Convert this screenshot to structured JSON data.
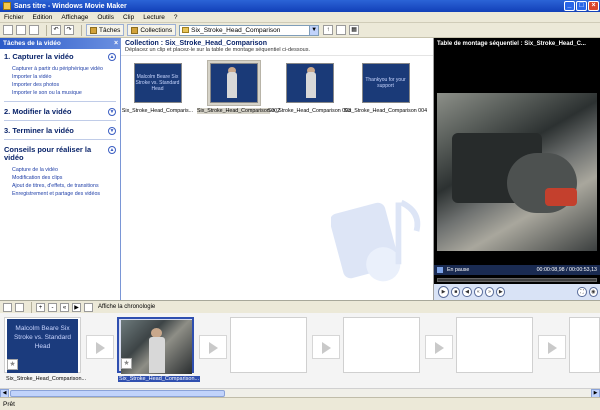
{
  "window": {
    "title": "Sans titre - Windows Movie Maker"
  },
  "menu": [
    "Fichier",
    "Edition",
    "Affichage",
    "Outils",
    "Clip",
    "Lecture",
    "?"
  ],
  "toolbar": {
    "tasks_label": "Tâches",
    "collections_label": "Collections",
    "collection_select": "Six_Stroke_Head_Comparison"
  },
  "taskpane": {
    "header": "Tâches de la vidéo",
    "sections": [
      {
        "title": "1. Capturer la vidéo",
        "links": [
          "Capturer à partir du périphérique vidéo",
          "Importer la vidéo",
          "Importer des photos",
          "Importer le son ou la musique"
        ]
      },
      {
        "title": "2. Modifier la vidéo",
        "links": []
      },
      {
        "title": "3. Terminer la vidéo",
        "links": []
      },
      {
        "title": "Conseils pour réaliser la vidéo",
        "links": [
          "Capture de la vidéo",
          "Modification des clips",
          "Ajout de titres, d'effets, de transitions",
          "Enregistrement et partage des vidéos"
        ]
      }
    ]
  },
  "collection": {
    "title": "Collection : Six_Stroke_Head_Comparison",
    "subtitle": "Déplacez un clip et placez-le sur la table de montage séquentiel ci-dessous.",
    "clips": [
      {
        "caption": "Six_Stroke_Head_Comparis...",
        "thumb_text": "Malcolm Beare Six Stroke vs. Standard Head",
        "kind": "title"
      },
      {
        "caption": "Six_Stroke_Head_Comparison 002",
        "thumb_text": "",
        "kind": "photo"
      },
      {
        "caption": "Six_Stroke_Head_Comparison 003",
        "thumb_text": "",
        "kind": "photo"
      },
      {
        "caption": "Six_Stroke_Head_Comparison 004",
        "thumb_text": "Thankyou for your support",
        "kind": "title"
      }
    ]
  },
  "monitor": {
    "title": "Table de montage séquentiel : Six_Stroke_Head_C...",
    "status": "En pause",
    "time": "00:00:08,98 / 00:00:53,13"
  },
  "storyboard": {
    "toolbar_label": "Affiche la chronologie",
    "frames": [
      {
        "caption": "Six_Stroke_Head_Comparison...",
        "text": "Malcolm Beare Six Stroke vs. Standard Head",
        "kind": "title"
      },
      {
        "caption": "Six_Stroke_Head_Comparison...",
        "text": "",
        "kind": "photo"
      }
    ]
  },
  "status": {
    "text": "Prêt"
  }
}
